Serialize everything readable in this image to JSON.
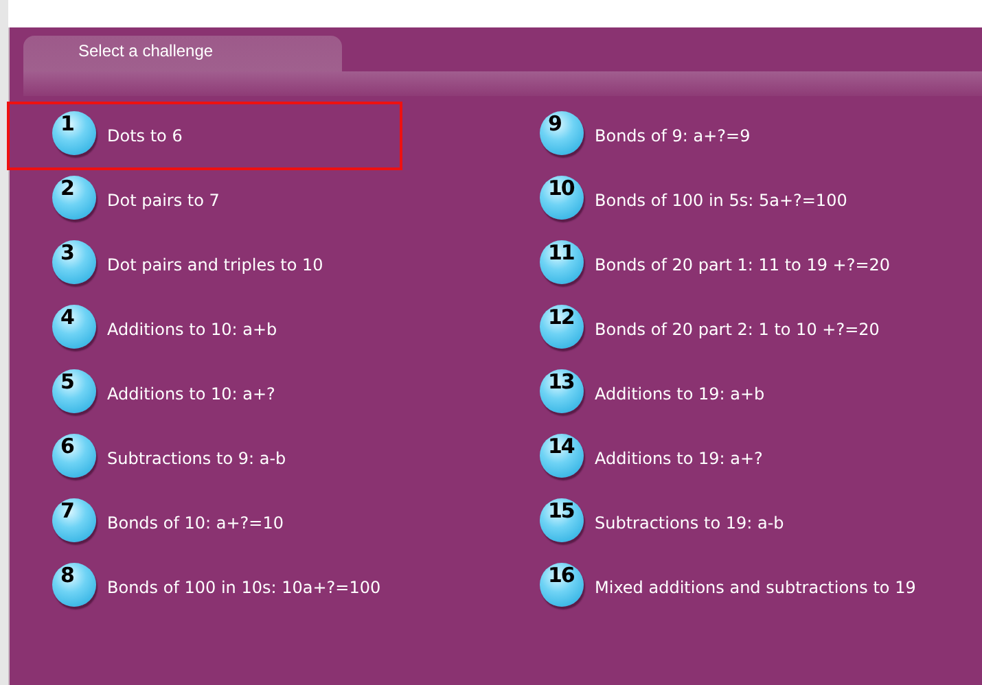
{
  "tabs": [
    {
      "label": "Select a challenge",
      "selected": true
    }
  ],
  "challenges": [
    {
      "number": "1",
      "label": "Dots to 6",
      "selected": true
    },
    {
      "number": "2",
      "label": "Dot pairs to 7",
      "selected": false
    },
    {
      "number": "3",
      "label": "Dot pairs and triples to 10",
      "selected": false
    },
    {
      "number": "4",
      "label": "Additions to 10: a+b",
      "selected": false
    },
    {
      "number": "5",
      "label": "Additions to 10: a+?",
      "selected": false
    },
    {
      "number": "6",
      "label": "Subtractions to 9: a-b",
      "selected": false
    },
    {
      "number": "7",
      "label": "Bonds of 10: a+?=10",
      "selected": false
    },
    {
      "number": "8",
      "label": "Bonds of 100 in 10s: 10a+?=100",
      "selected": false
    },
    {
      "number": "9",
      "label": "Bonds of 9: a+?=9",
      "selected": false
    },
    {
      "number": "10",
      "label": "Bonds of 100 in 5s: 5a+?=100",
      "selected": false
    },
    {
      "number": "11",
      "label": "Bonds of 20 part 1: 11 to 19 +?=20",
      "selected": false
    },
    {
      "number": "12",
      "label": "Bonds of 20 part 2: 1 to 10 +?=20",
      "selected": false
    },
    {
      "number": "13",
      "label": "Additions to 19: a+b",
      "selected": false
    },
    {
      "number": "14",
      "label": "Additions to 19: a+?",
      "selected": false
    },
    {
      "number": "15",
      "label": "Subtractions to 19: a-b",
      "selected": false
    },
    {
      "number": "16",
      "label": "Mixed additions and subtractions to 19",
      "selected": false
    }
  ]
}
